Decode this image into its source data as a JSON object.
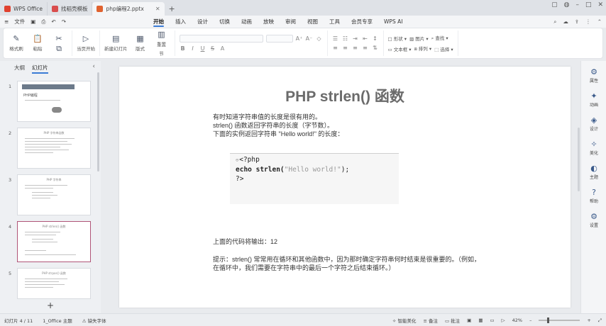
{
  "tabs": [
    {
      "label": "WPS Office",
      "color": "#e0412f"
    },
    {
      "label": "找稻壳模板",
      "color": "#d94d4d"
    },
    {
      "label": "php编程2.pptx",
      "color": "#e0622f"
    }
  ],
  "menu": {
    "file": "文件",
    "ribbon_tabs": [
      "开始",
      "插入",
      "设计",
      "切换",
      "动画",
      "放映",
      "审阅",
      "视图",
      "工具",
      "会员专享"
    ],
    "active_tab": "开始",
    "wps_ai": "WPS AI"
  },
  "ribbon": {
    "format_painter": "格式刷",
    "paste": "粘贴",
    "from_current": "当页开始",
    "new_slide": "新建幻灯片",
    "layout": "版式",
    "section": "节",
    "reset": "重置",
    "shape": "形状",
    "textbox": "文本框",
    "picture": "图片",
    "arrange": "排列",
    "find": "查找",
    "select": "选择"
  },
  "left_panel": {
    "tab_outline": "大纲",
    "tab_slides": "幻灯片",
    "thumbs": [
      {
        "num": "1",
        "title": "PHP编程"
      },
      {
        "num": "2",
        "title": "PHP 字符串函数"
      },
      {
        "num": "3",
        "title": "PHP 字符串"
      },
      {
        "num": "4",
        "title": "PHP strlen() 函数"
      },
      {
        "num": "5",
        "title": "PHP strpos() 函数"
      }
    ],
    "selected": "4"
  },
  "slide": {
    "title": "PHP strlen() 函数",
    "body": [
      "有时知道字符串值的长度是很有用的。",
      "strlen() 函数返回字符串的长度（字节数）。",
      "下面的实例返回字符串 \"Hello world!\" 的长度："
    ],
    "code": {
      "line1": "<?php",
      "line2_kw": "echo strlen(",
      "line2_str": "\"Hello world!\"",
      "line2_end": ");",
      "line3": "?>"
    },
    "output": "上面的代码将输出：12",
    "tip": "提示：strlen() 常常用在循环和其他函数中，因为那时确定字符串何时结束是很重要的。（例如，在循环中，我们需要在字符串中的最后一个字符之后结束循环。）"
  },
  "right_bar": [
    "属性",
    "动画",
    "设计",
    "美化",
    "主题",
    "帮助",
    "设置"
  ],
  "status": {
    "slide_count": "幻灯片 4 / 11",
    "theme": "1_Office 主题",
    "missing_font": "缺失字体",
    "beautify": "智能美化",
    "notes": "备注",
    "comments": "批注",
    "zoom": "42%",
    "zoom_level": 0.42
  }
}
